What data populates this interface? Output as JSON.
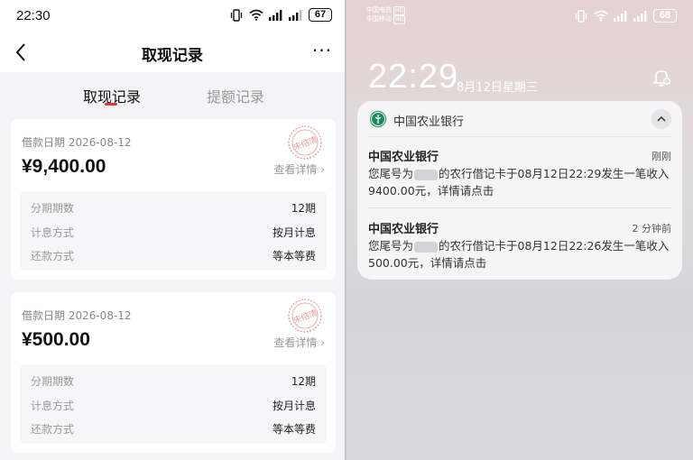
{
  "left": {
    "status_bar": {
      "time": "22:30",
      "battery": "67"
    },
    "nav": {
      "title": "取现记录",
      "more": "···"
    },
    "tabs": [
      {
        "label": "取现记录",
        "active": true
      },
      {
        "label": "提额记录",
        "active": false
      }
    ],
    "records": [
      {
        "date": "借款日期 2026-08-12",
        "amount": "¥9,400.00",
        "link": "查看详情",
        "stamp_text": "未结清",
        "details": [
          {
            "label": "分期期数",
            "value": "12期"
          },
          {
            "label": "计息方式",
            "value": "按月计息"
          },
          {
            "label": "还款方式",
            "value": "等本等费"
          }
        ]
      },
      {
        "date": "借款日期 2026-08-12",
        "amount": "¥500.00",
        "link": "查看详情",
        "stamp_text": "未结清",
        "details": [
          {
            "label": "分期期数",
            "value": "12期"
          },
          {
            "label": "计息方式",
            "value": "按月计息"
          },
          {
            "label": "还款方式",
            "value": "等本等费"
          }
        ]
      }
    ]
  },
  "right": {
    "status_bar": {
      "carrier1": "中国电信",
      "carrier2": "中国移动",
      "carrier_tag": "HD",
      "battery": "68"
    },
    "lock": {
      "time": "22:29",
      "date": "8月12日星期三"
    },
    "notification_group": {
      "app": "中国农业银行",
      "items": [
        {
          "title": "中国农业银行",
          "time": "刚刚",
          "body_prefix": "您尾号为",
          "body_suffix": "的农行借记卡于08月12日22:29发生一笔收入9400.00元，详情请点击"
        },
        {
          "title": "中国农业银行",
          "time": "2 分钟前",
          "body_prefix": "您尾号为",
          "body_suffix": "的农行借记卡于08月12日22:26发生一笔收入500.00元，详情请点击"
        }
      ]
    }
  },
  "colors": {
    "accent_red": "#e8323a",
    "bank_green": "#1a8a5c"
  }
}
